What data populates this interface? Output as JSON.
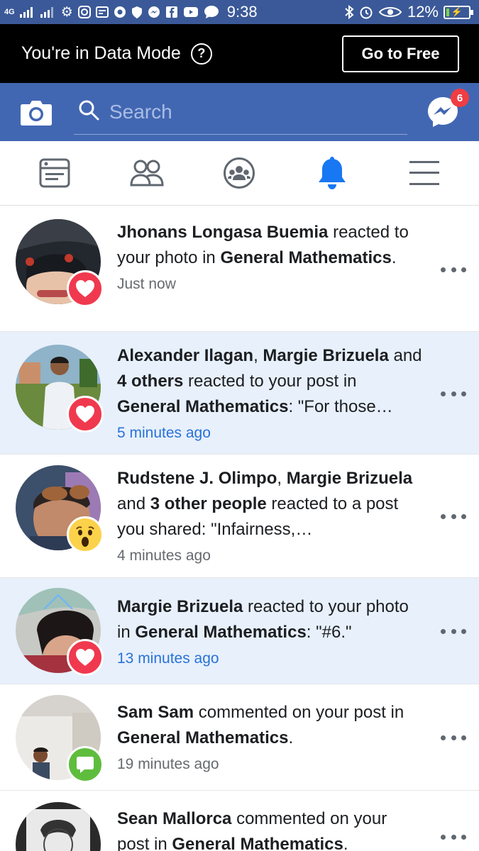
{
  "status_bar": {
    "network_label": "4G",
    "time": "9:38",
    "battery_percent": "12%",
    "battery_level": 0.12,
    "left_icons": [
      "signal-icon",
      "signal-icon",
      "settings-icon",
      "instagram-icon",
      "news-icon",
      "chrome-icon",
      "shield-icon",
      "messenger-icon",
      "facebook-icon",
      "youtube-icon",
      "chat-icon"
    ],
    "right_icons": [
      "bluetooth-icon",
      "alarm-icon",
      "eye-icon",
      "battery-icon"
    ]
  },
  "data_mode": {
    "text": "You're in Data Mode",
    "help_symbol": "?",
    "button_label": "Go to Free"
  },
  "header": {
    "search_placeholder": "Search",
    "messenger_badge": "6"
  },
  "tabs": [
    {
      "name": "news-feed",
      "icon": "news-feed-icon",
      "active": false
    },
    {
      "name": "friends",
      "icon": "friends-icon",
      "active": false
    },
    {
      "name": "groups",
      "icon": "groups-icon",
      "active": false
    },
    {
      "name": "notifications",
      "icon": "bell-icon",
      "active": true
    },
    {
      "name": "menu",
      "icon": "hamburger-icon",
      "active": false
    }
  ],
  "notifications": [
    {
      "unread": false,
      "reaction": "love",
      "parts": [
        {
          "t": "Jhonans Longasa Buemia",
          "b": true
        },
        {
          "t": " reacted to your photo in ",
          "b": false
        },
        {
          "t": "General Mathematics",
          "b": true
        },
        {
          "t": ".",
          "b": false
        }
      ],
      "time": "Just now"
    },
    {
      "unread": true,
      "reaction": "love",
      "parts": [
        {
          "t": "Alexander Ilagan",
          "b": true
        },
        {
          "t": ", ",
          "b": false
        },
        {
          "t": "Margie Brizuela",
          "b": true
        },
        {
          "t": " and ",
          "b": false
        },
        {
          "t": "4 others",
          "b": true
        },
        {
          "t": " reacted to your post in ",
          "b": false
        },
        {
          "t": "General Mathematics",
          "b": true
        },
        {
          "t": ": \"For those…",
          "b": false
        }
      ],
      "time": "5 minutes ago"
    },
    {
      "unread": false,
      "reaction": "wow",
      "parts": [
        {
          "t": "Rudstene J. Olimpo",
          "b": true
        },
        {
          "t": ", ",
          "b": false
        },
        {
          "t": "Margie Brizuela",
          "b": true
        },
        {
          "t": " and ",
          "b": false
        },
        {
          "t": "3 other people",
          "b": true
        },
        {
          "t": " reacted to a post you shared: \"Infairness,…",
          "b": false
        }
      ],
      "time": "4 minutes ago"
    },
    {
      "unread": true,
      "reaction": "love",
      "parts": [
        {
          "t": "Margie Brizuela",
          "b": true
        },
        {
          "t": " reacted to your photo in ",
          "b": false
        },
        {
          "t": "General Mathematics",
          "b": true
        },
        {
          "t": ": \"#6.\"",
          "b": false
        }
      ],
      "time": "13 minutes ago"
    },
    {
      "unread": false,
      "reaction": "comment",
      "parts": [
        {
          "t": "Sam Sam",
          "b": true
        },
        {
          "t": " commented on your post in ",
          "b": false
        },
        {
          "t": "General Mathematics",
          "b": true
        },
        {
          "t": ".",
          "b": false
        }
      ],
      "time": "19 minutes ago"
    },
    {
      "unread": false,
      "reaction": "comment",
      "parts": [
        {
          "t": "Sean Mallorca",
          "b": true
        },
        {
          "t": " commented on your post in ",
          "b": false
        },
        {
          "t": "General Mathematics",
          "b": true
        },
        {
          "t": ".",
          "b": false
        }
      ],
      "time": ""
    }
  ],
  "colors": {
    "facebook_blue": "#4267b2",
    "status_bar": "#3b5998",
    "unread_background": "#e7f0fb",
    "love": "#f0394e",
    "wow": "#fcd24b",
    "comment": "#5fbd3e",
    "unread_time": "#2a72d8"
  }
}
